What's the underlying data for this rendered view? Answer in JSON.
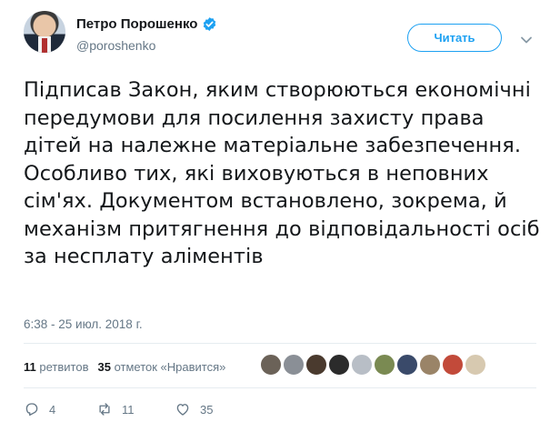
{
  "author": {
    "display_name": "Петро Порошенко",
    "handle": "@poroshenko",
    "verified": true
  },
  "follow_button": {
    "label": "Читать"
  },
  "tweet": {
    "text": "Підписав Закон, яким створюються економічні передумови для посилення захисту права дітей на належне матеріальне забезпечення. Особливо тих, які виховуються в неповних сім'ях. Документом встановлено, зокрема, й механізм притягнення до відповідальності осіб за несплату аліментів",
    "timestamp": "6:38 - 25 июл. 2018 г."
  },
  "stats": {
    "retweets_count": "11",
    "retweets_label": "ретвитов",
    "likes_count": "35",
    "likes_label": "отметок «Нравится»"
  },
  "likers": [
    {
      "color": "#6b6258"
    },
    {
      "color": "#8a8f96"
    },
    {
      "color": "#4a3a2e"
    },
    {
      "color": "#2b2b2b"
    },
    {
      "color": "#b8bec6"
    },
    {
      "color": "#7a8a52"
    },
    {
      "color": "#3a4a6a"
    },
    {
      "color": "#9a8468"
    },
    {
      "color": "#c24a3a"
    },
    {
      "color": "#d7c9b0"
    }
  ],
  "actions": {
    "reply_count": "4",
    "retweet_count": "11",
    "like_count": "35"
  },
  "colors": {
    "accent": "#1da1f2",
    "muted": "#657786",
    "text": "#14171a",
    "verified": "#1da1f2"
  },
  "icons": [
    "verified-icon",
    "caret-down-icon",
    "reply-icon",
    "retweet-icon",
    "heart-icon"
  ]
}
